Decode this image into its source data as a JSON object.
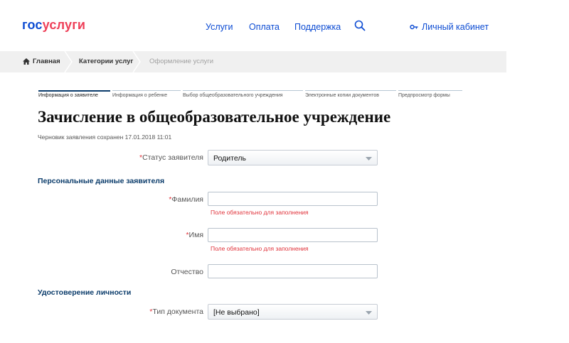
{
  "header": {
    "logo_part1": "гос",
    "logo_part2": "услуги",
    "nav": {
      "services": "Услуги",
      "payment": "Оплата",
      "support": "Поддержка"
    },
    "cabinet": "Личный кабинет"
  },
  "breadcrumb": {
    "home": "Главная",
    "categories": "Категории услуг",
    "current": "Оформление услуги"
  },
  "steps": [
    {
      "label": "Информация о заявителе",
      "active": true
    },
    {
      "label": "Информация о ребенке",
      "active": false
    },
    {
      "label": "Выбор общеобразовательного учреждения",
      "active": false
    },
    {
      "label": "Электронные копии документов",
      "active": false
    },
    {
      "label": "Предпросмотр формы",
      "active": false
    }
  ],
  "page": {
    "title": "Зачисление в общеобразовательное учреждение",
    "draft_status": "Черновик заявления сохранен 17.01.2018 11:01"
  },
  "form": {
    "applicant_status": {
      "label": "Статус заявителя",
      "value": "Родитель",
      "required": true
    },
    "section_personal": "Персональные данные заявителя",
    "last_name": {
      "label": "Фамилия",
      "value": "",
      "required": true,
      "error": "Поле обязательно для заполнения"
    },
    "first_name": {
      "label": "Имя",
      "value": "",
      "required": true,
      "error": "Поле обязательно для заполнения"
    },
    "patronymic": {
      "label": "Отчество",
      "value": "",
      "required": false
    },
    "section_identity": "Удостоверение личности",
    "document_type": {
      "label": "Тип документа",
      "value": "[Не выбрано]",
      "required": true
    }
  },
  "colors": {
    "brand_blue": "#0d4cd3",
    "brand_red": "#ee3f58",
    "section_blue": "#0b3c6b",
    "error_red": "#e0333b"
  },
  "icons": [
    "search-icon",
    "key-icon",
    "home-icon",
    "chevron-down-icon"
  ]
}
